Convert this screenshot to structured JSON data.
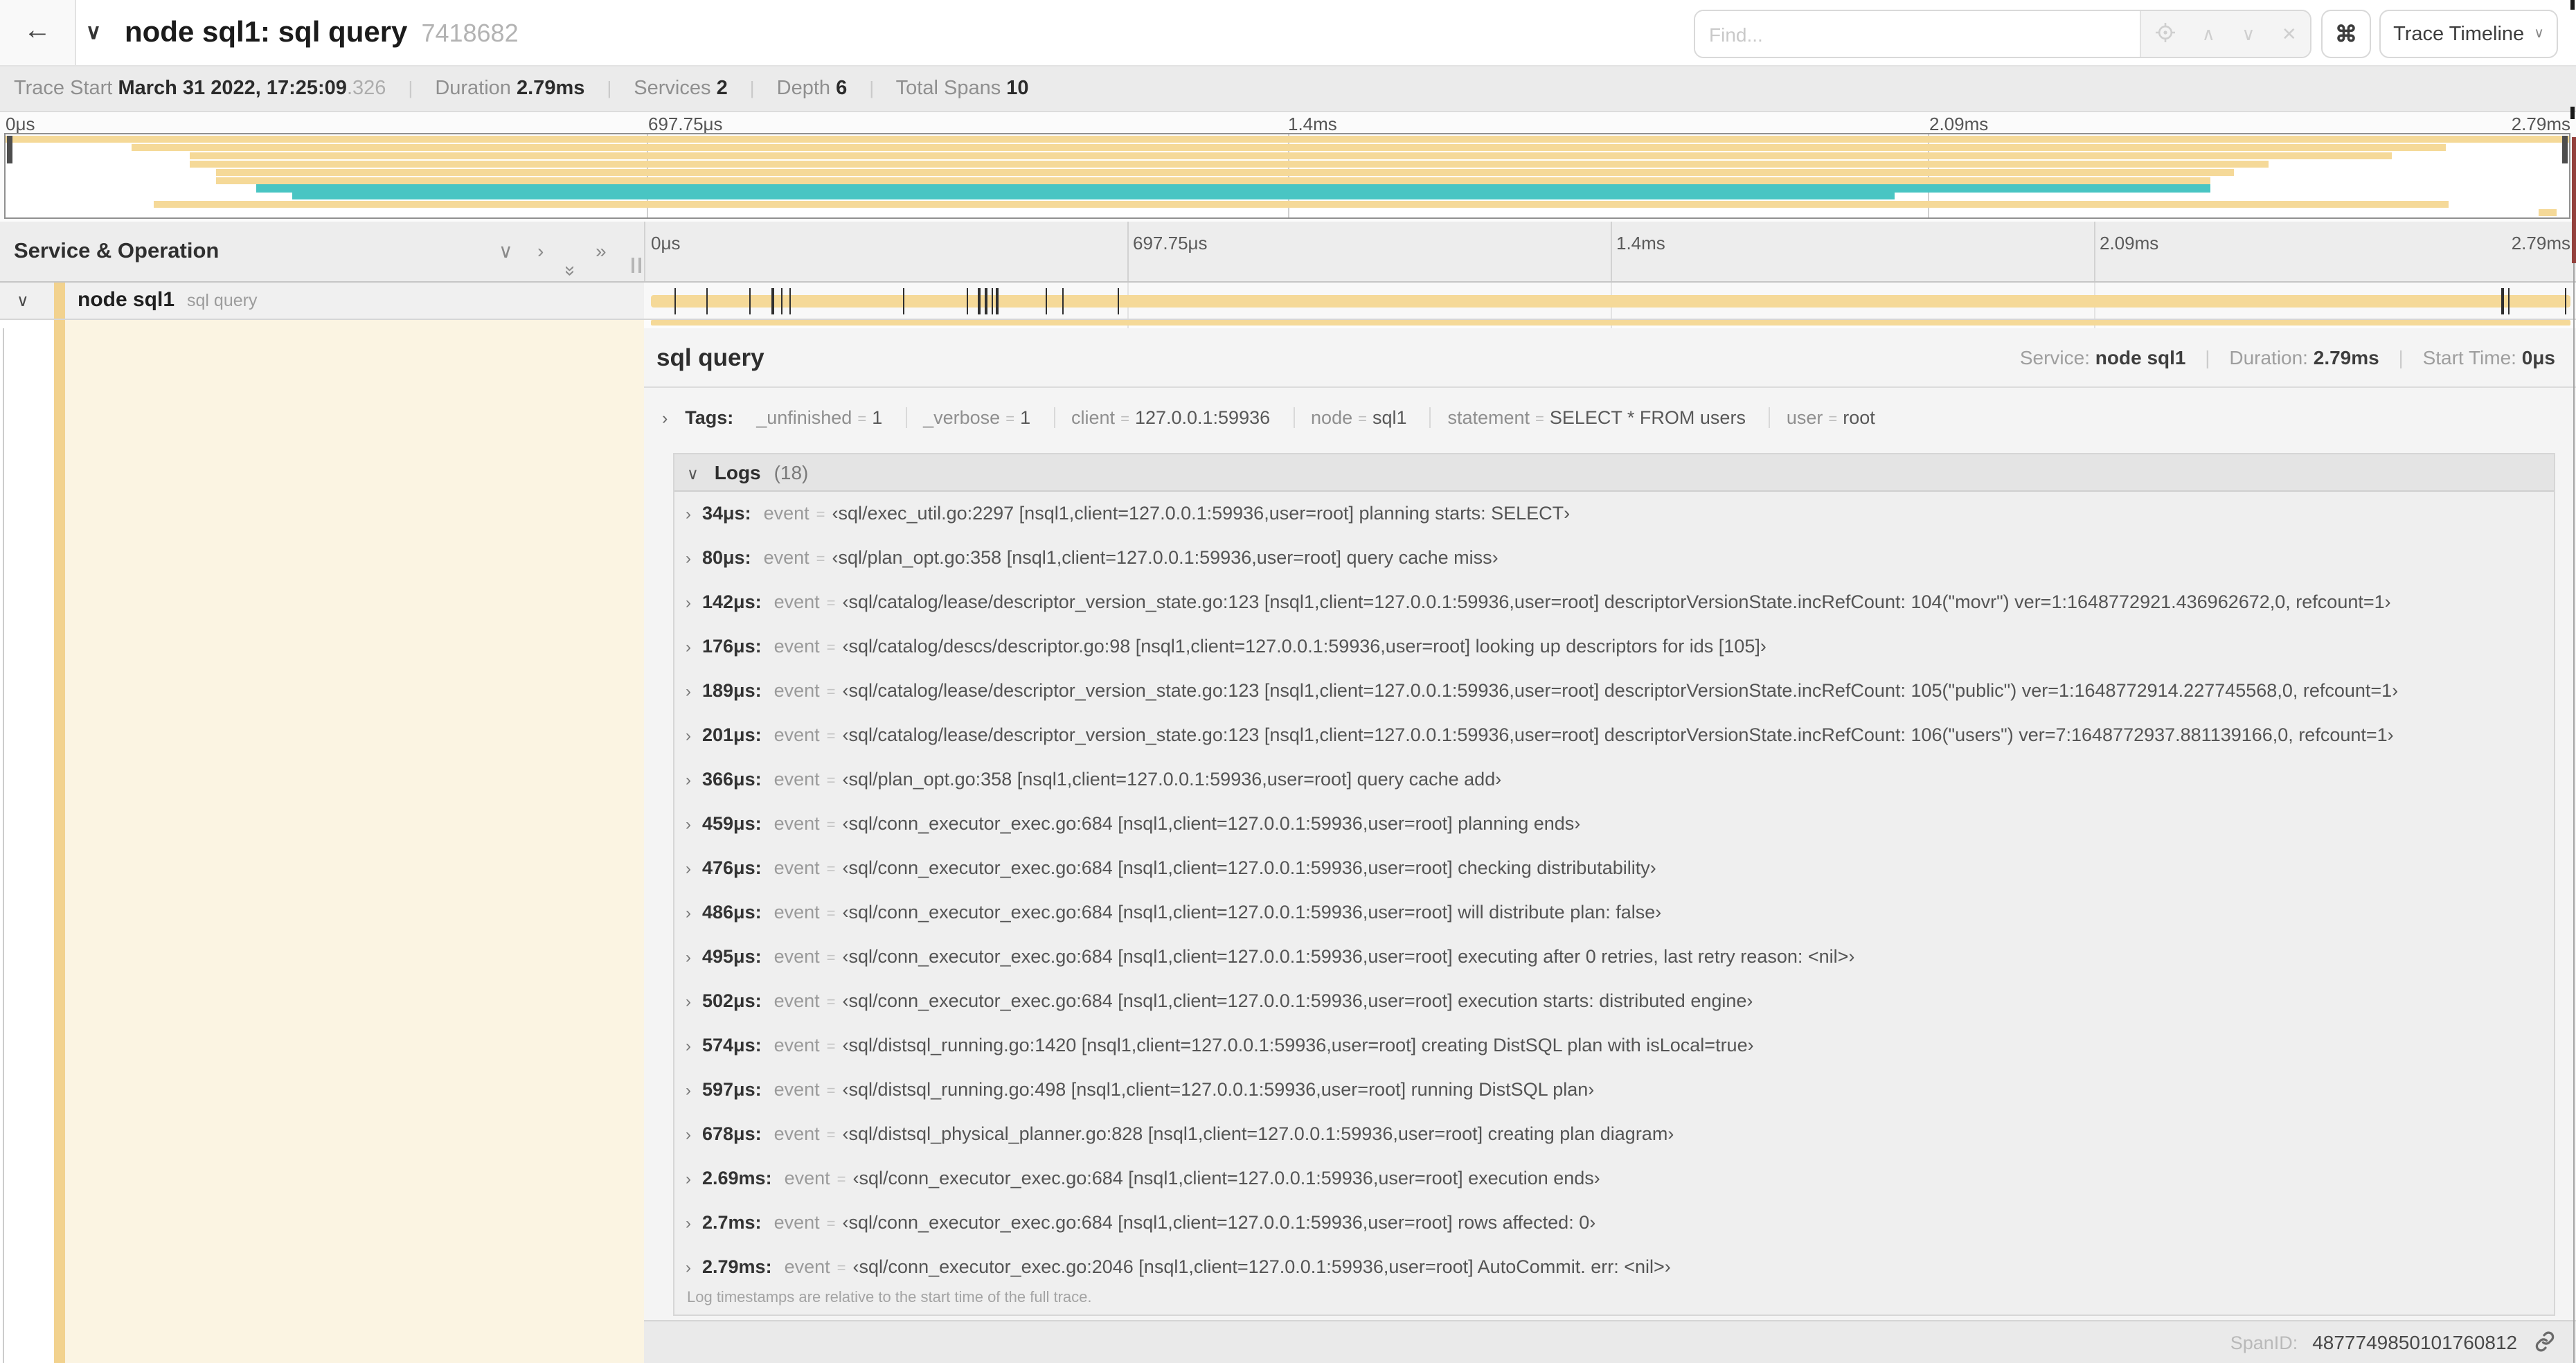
{
  "colors": {
    "tan": "#F5D998",
    "tan_dark": "#F2D28E",
    "teal": "#49C5C3",
    "maroon": "#93403C"
  },
  "header": {
    "back_icon": "←",
    "title_chevron": "∨",
    "title": "node sql1: sql query",
    "trace_id": "7418682",
    "find_placeholder": "Find...",
    "find_icons": {
      "scope": "◎",
      "prev": "∧",
      "next": "∨",
      "clear": "✕"
    },
    "cmd_icon": "⌘",
    "view_button": "Trace Timeline",
    "view_chevron": "∨"
  },
  "trace_info": {
    "start_label": "Trace Start",
    "start_value": "March 31 2022, 17:25:09",
    "start_ms": ".326",
    "duration_label": "Duration",
    "duration_value": "2.79ms",
    "services_label": "Services",
    "services_value": "2",
    "depth_label": "Depth",
    "depth_value": "6",
    "spans_label": "Total Spans",
    "spans_value": "10"
  },
  "minimap": {
    "ticks": [
      "0μs",
      "697.75μs",
      "1.4ms",
      "2.09ms",
      "2.79ms"
    ],
    "spans": [
      {
        "start": 0,
        "end": 100,
        "color": "tan"
      },
      {
        "start": 4.9,
        "end": 95.2,
        "color": "tan"
      },
      {
        "start": 7.2,
        "end": 93.1,
        "color": "tan"
      },
      {
        "start": 7.2,
        "end": 88.3,
        "color": "tan"
      },
      {
        "start": 8.2,
        "end": 86.9,
        "color": "tan"
      },
      {
        "start": 8.2,
        "end": 86.0,
        "color": "tan"
      },
      {
        "start": 9.8,
        "end": 86.0,
        "color": "teal"
      },
      {
        "start": 11.2,
        "end": 73.7,
        "color": "teal"
      },
      {
        "start": 5.8,
        "end": 95.3,
        "color": "tan"
      },
      {
        "start": 98.8,
        "end": 99.5,
        "color": "tan"
      }
    ]
  },
  "timeline": {
    "column_header": "Service & Operation",
    "icons": {
      "collapse_one": "∨",
      "expand_one": "›",
      "collapse_all": "»",
      "expand_all": "»"
    },
    "ticks": [
      "0μs",
      "697.75μs",
      "1.4ms",
      "2.09ms",
      "2.79ms"
    ],
    "row": {
      "chevron": "∨",
      "service": "node sql1",
      "operation": "sql query"
    },
    "duration_us": 2790,
    "log_times_us": [
      34,
      80,
      142,
      176,
      189,
      201,
      366,
      459,
      476,
      486,
      495,
      502,
      574,
      597,
      678,
      2690,
      2700,
      2790
    ]
  },
  "detail": {
    "title": "sql query",
    "service_label": "Service:",
    "service_value": "node sql1",
    "duration_label": "Duration:",
    "duration_value": "2.79ms",
    "start_label": "Start Time:",
    "start_value": "0μs",
    "tags_chevron": "›",
    "tags_label": "Tags:",
    "tags": [
      {
        "key": "_unfinished",
        "eq": "=",
        "value": "1"
      },
      {
        "key": "_verbose",
        "eq": "=",
        "value": "1"
      },
      {
        "key": "client",
        "eq": "=",
        "value": "127.0.0.1:59936"
      },
      {
        "key": "node",
        "eq": "=",
        "value": "sql1"
      },
      {
        "key": "statement",
        "eq": "=",
        "value": "SELECT * FROM users"
      },
      {
        "key": "user",
        "eq": "=",
        "value": "root"
      }
    ],
    "logs_chevron": "∨",
    "logs_label": "Logs",
    "logs_count": "(18)",
    "log_row_chevron": "›",
    "log_event_key": "event",
    "log_eq": "=",
    "logs": [
      {
        "time": "34μs:",
        "value": "‹sql/exec_util.go:2297 [nsql1,client=127.0.0.1:59936,user=root] planning starts: SELECT›"
      },
      {
        "time": "80μs:",
        "value": "‹sql/plan_opt.go:358 [nsql1,client=127.0.0.1:59936,user=root] query cache miss›"
      },
      {
        "time": "142μs:",
        "value": "‹sql/catalog/lease/descriptor_version_state.go:123 [nsql1,client=127.0.0.1:59936,user=root] descriptorVersionState.incRefCount: 104(\"movr\") ver=1:1648772921.436962672,0, refcount=1›"
      },
      {
        "time": "176μs:",
        "value": "‹sql/catalog/descs/descriptor.go:98 [nsql1,client=127.0.0.1:59936,user=root] looking up descriptors for ids [105]›"
      },
      {
        "time": "189μs:",
        "value": "‹sql/catalog/lease/descriptor_version_state.go:123 [nsql1,client=127.0.0.1:59936,user=root] descriptorVersionState.incRefCount: 105(\"public\") ver=1:1648772914.227745568,0, refcount=1›"
      },
      {
        "time": "201μs:",
        "value": "‹sql/catalog/lease/descriptor_version_state.go:123 [nsql1,client=127.0.0.1:59936,user=root] descriptorVersionState.incRefCount: 106(\"users\") ver=7:1648772937.881139166,0, refcount=1›"
      },
      {
        "time": "366μs:",
        "value": "‹sql/plan_opt.go:358 [nsql1,client=127.0.0.1:59936,user=root] query cache add›"
      },
      {
        "time": "459μs:",
        "value": "‹sql/conn_executor_exec.go:684 [nsql1,client=127.0.0.1:59936,user=root] planning ends›"
      },
      {
        "time": "476μs:",
        "value": "‹sql/conn_executor_exec.go:684 [nsql1,client=127.0.0.1:59936,user=root] checking distributability›"
      },
      {
        "time": "486μs:",
        "value": "‹sql/conn_executor_exec.go:684 [nsql1,client=127.0.0.1:59936,user=root] will distribute plan: false›"
      },
      {
        "time": "495μs:",
        "value": "‹sql/conn_executor_exec.go:684 [nsql1,client=127.0.0.1:59936,user=root] executing after 0 retries, last retry reason: <nil>›"
      },
      {
        "time": "502μs:",
        "value": "‹sql/conn_executor_exec.go:684 [nsql1,client=127.0.0.1:59936,user=root] execution starts: distributed engine›"
      },
      {
        "time": "574μs:",
        "value": "‹sql/distsql_running.go:1420 [nsql1,client=127.0.0.1:59936,user=root] creating DistSQL plan with isLocal=true›"
      },
      {
        "time": "597μs:",
        "value": "‹sql/distsql_running.go:498 [nsql1,client=127.0.0.1:59936,user=root] running DistSQL plan›"
      },
      {
        "time": "678μs:",
        "value": "‹sql/distsql_physical_planner.go:828 [nsql1,client=127.0.0.1:59936,user=root] creating plan diagram›"
      },
      {
        "time": "2.69ms:",
        "value": "‹sql/conn_executor_exec.go:684 [nsql1,client=127.0.0.1:59936,user=root] execution ends›"
      },
      {
        "time": "2.7ms:",
        "value": "‹sql/conn_executor_exec.go:684 [nsql1,client=127.0.0.1:59936,user=root] rows affected: 0›"
      },
      {
        "time": "2.79ms:",
        "value": "‹sql/conn_executor_exec.go:2046 [nsql1,client=127.0.0.1:59936,user=root] AutoCommit. err: <nil>›"
      }
    ],
    "logs_footer": "Log timestamps are relative to the start time of the full trace.",
    "spanid_label": "SpanID:",
    "spanid_value": "4877749850101760812"
  }
}
